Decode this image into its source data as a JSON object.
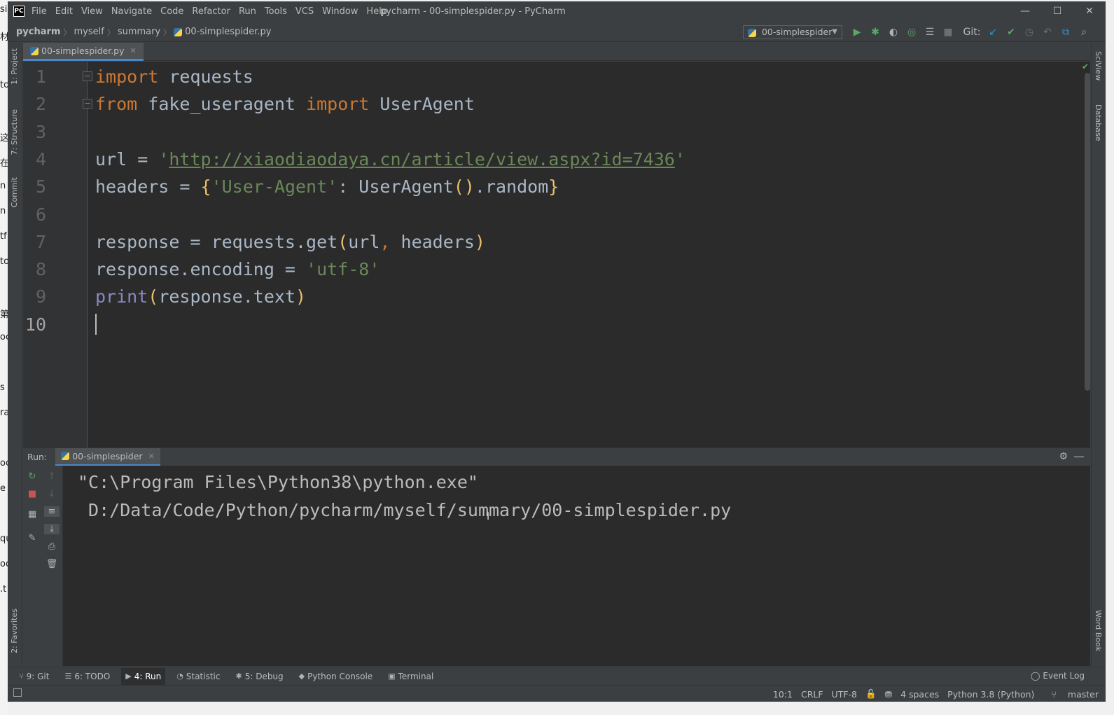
{
  "background_strip": [
    "si",
    "材",
    "",
    "to",
    "",
    "这",
    "在",
    "n",
    "n",
    "tf",
    "to",
    "",
    "第",
    "oc",
    "",
    "s",
    "ra",
    "",
    "oo",
    "e",
    "",
    "qu",
    "oo",
    ".t"
  ],
  "window": {
    "title": "pycharm - 00-simplespider.py - PyCharm",
    "logo": "PC",
    "controls": [
      "—",
      "☐",
      "✕"
    ]
  },
  "menu": [
    "File",
    "Edit",
    "View",
    "Navigate",
    "Code",
    "Refactor",
    "Run",
    "Tools",
    "VCS",
    "Window",
    "Help"
  ],
  "breadcrumb": [
    "pycharm",
    "myself",
    "summary",
    "00-simplespider.py"
  ],
  "run_config": {
    "label": "00-simplespider"
  },
  "git_label": "Git:",
  "left_tabs": [
    "1: Project",
    "7: Structure",
    "Commit",
    "2: Favorites"
  ],
  "right_tabs": [
    "SciView",
    "Database",
    "Word Book"
  ],
  "editor_tab": {
    "label": "00-simplespider.py",
    "close": "✕"
  },
  "editor": {
    "line_numbers": [
      "1",
      "2",
      "3",
      "4",
      "5",
      "6",
      "7",
      "8",
      "9",
      "10"
    ],
    "lines": [
      [
        {
          "t": "import",
          "c": "kw"
        },
        {
          "t": " requests",
          "c": ""
        }
      ],
      [
        {
          "t": "from",
          "c": "kw"
        },
        {
          "t": " fake_useragent ",
          "c": ""
        },
        {
          "t": "import",
          "c": "kw"
        },
        {
          "t": " UserAgent",
          "c": ""
        }
      ],
      [],
      [
        {
          "t": "url = ",
          "c": ""
        },
        {
          "t": "'",
          "c": "str"
        },
        {
          "t": "http://xiaodiaodaya.cn/article/view.aspx?id=7436",
          "c": "url"
        },
        {
          "t": "'",
          "c": "str"
        }
      ],
      [
        {
          "t": "headers = ",
          "c": ""
        },
        {
          "t": "{",
          "c": "br"
        },
        {
          "t": "'User-Agent'",
          "c": "str"
        },
        {
          "t": ": UserAgent",
          "c": ""
        },
        {
          "t": "()",
          "c": "br"
        },
        {
          "t": ".random",
          "c": ""
        },
        {
          "t": "}",
          "c": "br"
        }
      ],
      [],
      [
        {
          "t": "response = requests.get",
          "c": ""
        },
        {
          "t": "(",
          "c": "br"
        },
        {
          "t": "url",
          "c": ""
        },
        {
          "t": ", ",
          "c": "kw"
        },
        {
          "t": "headers",
          "c": ""
        },
        {
          "t": ")",
          "c": "br"
        }
      ],
      [
        {
          "t": "response.encoding = ",
          "c": ""
        },
        {
          "t": "'utf-8'",
          "c": "str"
        }
      ],
      [
        {
          "t": "print",
          "c": "builtin"
        },
        {
          "t": "(",
          "c": "br"
        },
        {
          "t": "response.text",
          "c": ""
        },
        {
          "t": ")",
          "c": "br"
        }
      ],
      []
    ]
  },
  "run_panel": {
    "label": "Run:",
    "tab": "00-simplespider",
    "close": "✕",
    "console": [
      "\"C:\\Program Files\\Python38\\python.exe\"",
      " D:/Data/Code/Python/pycharm/myself/summary/00-simplespider.py"
    ]
  },
  "tool_tabs": [
    {
      "label": "9: Git",
      "icon": "⑂"
    },
    {
      "label": "6: TODO",
      "icon": "☰"
    },
    {
      "label": "4: Run",
      "icon": "▶",
      "active": true
    },
    {
      "label": "Statistic",
      "icon": "◔"
    },
    {
      "label": "5: Debug",
      "icon": "✱"
    },
    {
      "label": "Python Console",
      "icon": "◆"
    },
    {
      "label": "Terminal",
      "icon": "▣"
    }
  ],
  "event_log": "Event Log",
  "status": {
    "position": "10:1",
    "line_sep": "CRLF",
    "encoding": "UTF-8",
    "indent": "4 spaces",
    "interpreter": "Python 3.8 (Python)",
    "branch": "master"
  }
}
